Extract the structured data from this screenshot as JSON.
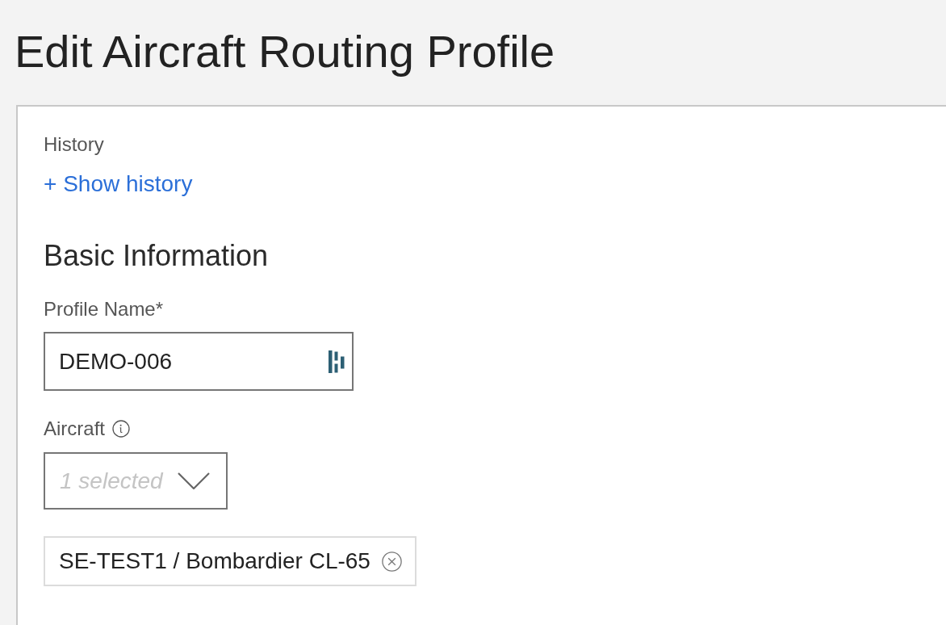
{
  "page": {
    "title": "Edit Aircraft Routing Profile"
  },
  "history": {
    "label": "History",
    "link": "+ Show history"
  },
  "section": {
    "title": "Basic Information"
  },
  "profile_name": {
    "label": "Profile Name*",
    "value": "DEMO-006"
  },
  "aircraft": {
    "label": "Aircraft",
    "dropdown": {
      "placeholder": "1 selected"
    },
    "selected_items": [
      {
        "label": "SE-TEST1 / Bombardier CL-65"
      }
    ]
  }
}
